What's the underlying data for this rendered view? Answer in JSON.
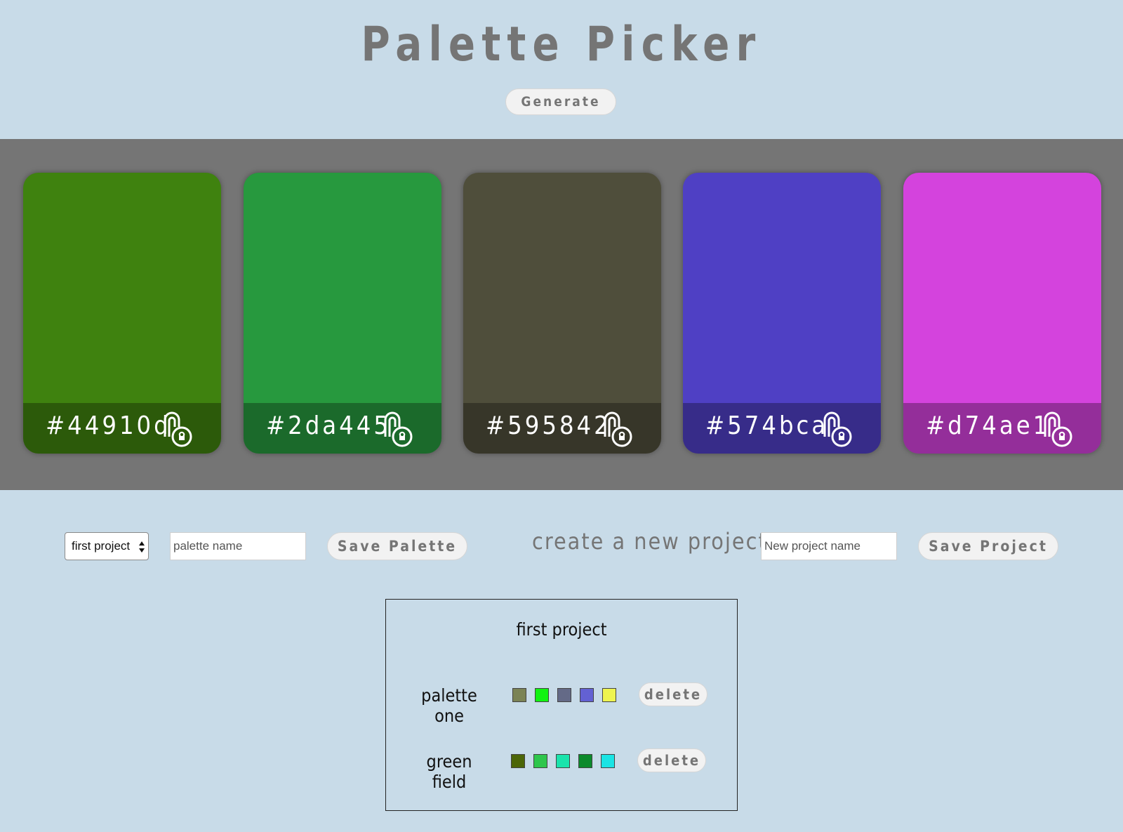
{
  "header": {
    "title": "Palette Picker",
    "generate_label": "Generate"
  },
  "palette": {
    "cards": [
      {
        "hex": "#44910d",
        "color": "#3f820f"
      },
      {
        "hex": "#2da445",
        "color": "#27993e"
      },
      {
        "hex": "#595842",
        "color": "#4f4e3b"
      },
      {
        "hex": "#574bca",
        "color": "#4f40c4"
      },
      {
        "hex": "#d74ae1",
        "color": "#d443dd"
      }
    ],
    "lock_icon": "unlocked-padlock-icon"
  },
  "controls": {
    "project_select_value": "first project",
    "palette_name_placeholder": "palette name",
    "save_palette_label": "Save Palette",
    "create_project_label": "create a new project:",
    "project_name_placeholder": "New project name",
    "save_project_label": "Save Project"
  },
  "project": {
    "title": "first project",
    "palettes": [
      {
        "name": "palette one",
        "colors": [
          "#7b8355",
          "#11f312",
          "#646a87",
          "#6361d3",
          "#eef450"
        ],
        "delete_label": "delete"
      },
      {
        "name": "green field",
        "colors": [
          "#4c6608",
          "#2ec64c",
          "#1ae3ac",
          "#0c8a2c",
          "#1ae4e4"
        ],
        "delete_label": "delete"
      }
    ]
  }
}
